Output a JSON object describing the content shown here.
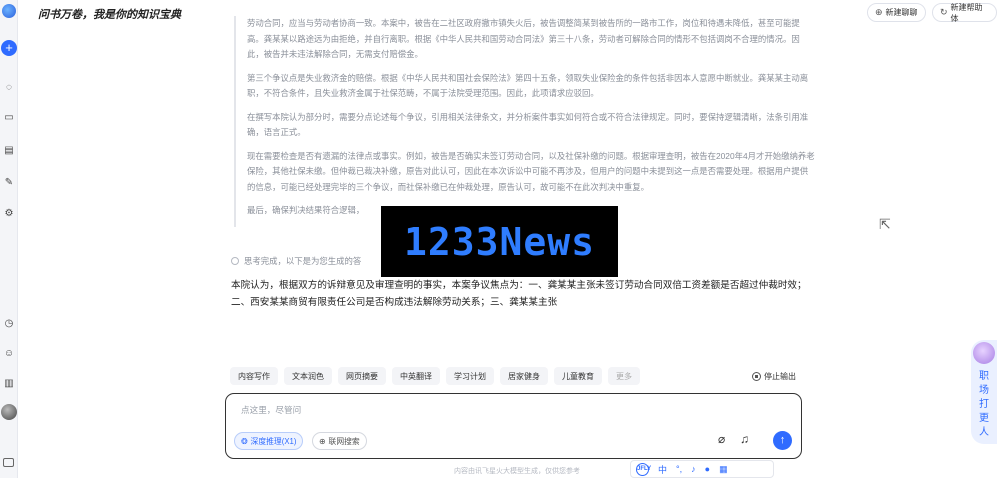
{
  "app": {
    "title": "问书万卷，我是你的知识宝典"
  },
  "header": {
    "new_chat_label": "新建聊聊",
    "new_helper_label": "新建帮助体"
  },
  "reasoning": {
    "paragraphs": [
      "劳动合同，应当与劳动者协商一致。本案中，被告在二社区政府撤市镇失火后，被告调整简某到被告所的一路市工作，岗位和待遇未降低，甚至可能提高。龚某某以路途远为由拒绝，并自行离职。根据《中华人民共和国劳动合同法》第三十八条，劳动者可解除合同的情形不包括调岗不合理的情况。因此，被告并未违法解除合同，无需支付赔偿金。",
      "第三个争议点是失业救济金的赔偿。根据《中华人民共和国社会保险法》第四十五条，领取失业保险金的条件包括非因本人意愿中断就业。龚某某主动离职，不符合条件，且失业救济金属于社保范畴，不属于法院受理范围。因此，此项请求应驳回。",
      "在撰写本院认为部分时，需要分点论述每个争议，引用相关法律条文，并分析案件事实如何符合或不符合法律规定。同时，要保持逻辑清晰，法条引用准确，语言正式。",
      "现在需要检查是否有遗漏的法律点或事实。例如，被告是否确实未签订劳动合同，以及社保补缴的问题。根据审理查明，被告在2020年4月才开始缴纳养老保险，其他社保未缴。但仲裁已裁决补缴，原告对此认可，因此在本次诉讼中可能不再涉及，但用户的问题中未提到这一点是否需要处理。根据用户提供的信息，可能已经处理完毕的三个争议，而社保补缴已在仲裁处理，原告认可，故可能不在此次判决中重复。",
      "最后，确保判决结果符合逻辑，"
    ],
    "done_label": "思考完成，以下是为您生成的答"
  },
  "answer": {
    "text": "本院认为，根据双方的诉辩意见及审理查明的事实，本案争议焦点为：一、龚某某主张未签订劳动合同双倍工资差额是否超过仲裁时效；二、西安某某商贸有限责任公司是否构成违法解除劳动关系；三、龚某某主张"
  },
  "watermark": {
    "text": "1233News"
  },
  "chips": [
    {
      "label": "内容写作"
    },
    {
      "label": "文本润色"
    },
    {
      "label": "网页摘要"
    },
    {
      "label": "中英翻译"
    },
    {
      "label": "学习计划"
    },
    {
      "label": "居家健身"
    },
    {
      "label": "儿童教育"
    },
    {
      "label": "更多"
    }
  ],
  "stop_label": "停止输出",
  "input": {
    "placeholder": "点这里，尽管问",
    "deep_reasoning_label": "深度推理(X1)",
    "web_search_label": "联网搜索"
  },
  "disclaimer": "内容由讯飞星火大模型生成，仅供您参考",
  "bottombar": {
    "logo": "JFLY",
    "lang": "中"
  },
  "floating": {
    "text": "职场打更人"
  },
  "colors": {
    "accent": "#2f6bff",
    "watermark_bg": "#000000"
  }
}
